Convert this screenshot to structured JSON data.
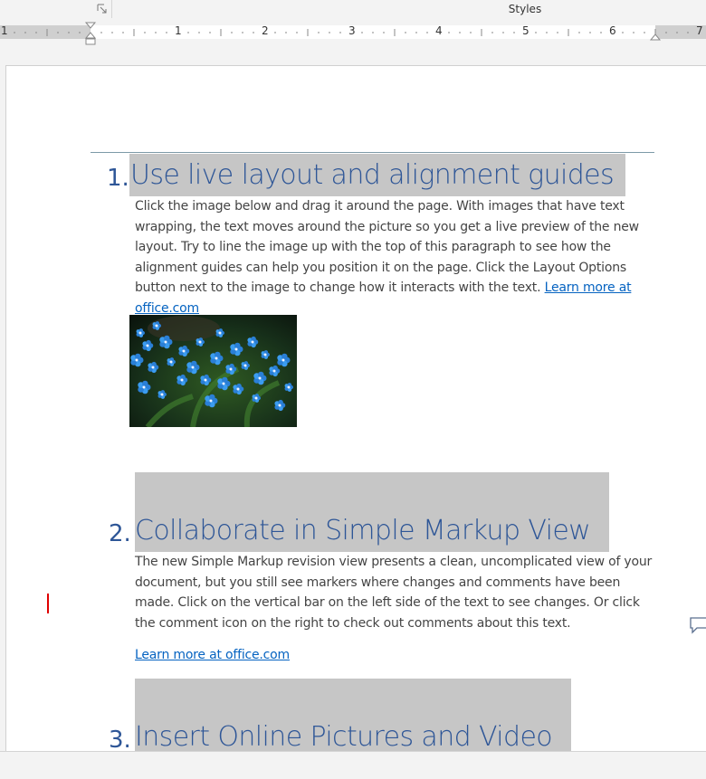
{
  "ribbon": {
    "group_label": "Styles",
    "launcher_icon": "dialog-launcher-icon"
  },
  "ruler": {
    "numbers": [
      "1",
      "1",
      "2",
      "3",
      "4",
      "5",
      "6",
      "7"
    ]
  },
  "document": {
    "sections": [
      {
        "number": "1.",
        "heading": "Use live layout and alignment guides",
        "body": "Click the image below and drag it around the page. With images that have text wrapping, the text moves around the picture so you get a live preview of the new layout. Try to line the image up with the top of this paragraph to see how the alignment guides can help you position it on the page.  Click the Layout Options button next to the image to change how it interacts with the text.",
        "link": "Learn more at office.com"
      },
      {
        "number": "2.",
        "heading": "Collaborate in Simple Markup View",
        "body": "The new Simple Markup revision view presents a clean, uncomplicated view of your document, but you still see markers where changes and comments have been made. Click on the vertical bar on the left side of the text to see changes. Or click the comment icon on the right to check out comments about this text.",
        "link": "Learn more at office.com"
      },
      {
        "number": "3.",
        "heading": "Insert Online Pictures and Video"
      }
    ],
    "image_icon": "flower-photo",
    "revision_marker_icon": "revision-bar-icon",
    "comment_icon": "comment-bubble-icon"
  },
  "colors": {
    "heading": "#2e5697",
    "highlight": "#c6c6c6",
    "link": "#0563c1",
    "revision_bar": "#e00000"
  }
}
